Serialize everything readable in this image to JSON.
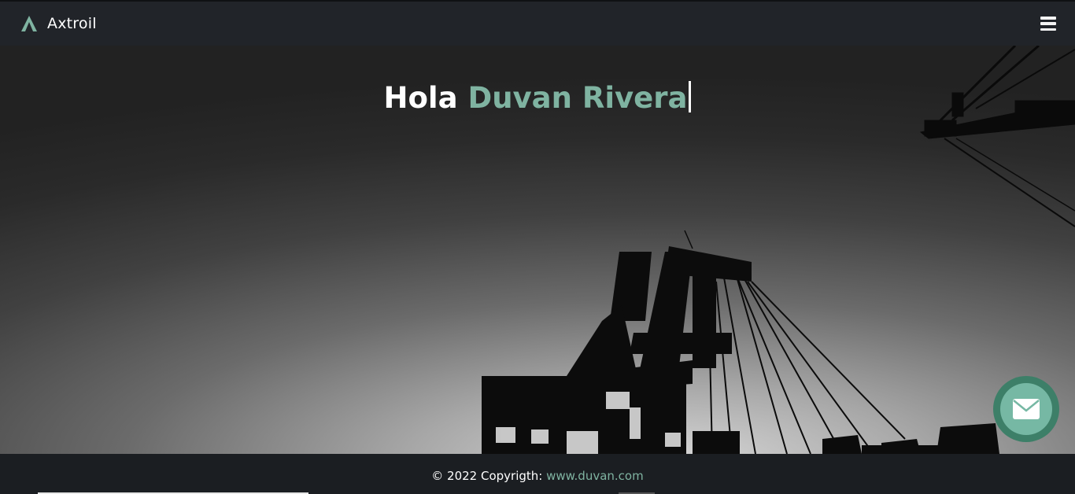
{
  "navbar": {
    "brand_name": "Axtroil",
    "logo_icon": "triangle-a-logo-icon",
    "menu_icon": "hamburger-menu-icon"
  },
  "hero": {
    "greeting_prefix": "Hola",
    "greeting_name": "Duvan Rivera",
    "background": "grayscale industrial crane silhouette at dusk"
  },
  "contact_fab": {
    "icon": "envelope-icon"
  },
  "footer": {
    "copyright_text": "© 2022 Copyrigth: ",
    "link_text": "www.duvan.com"
  },
  "colors": {
    "accent": "#7fb3a1",
    "fab": "#3d7f68",
    "navbar": "#212429",
    "footer": "#1b1e22"
  }
}
